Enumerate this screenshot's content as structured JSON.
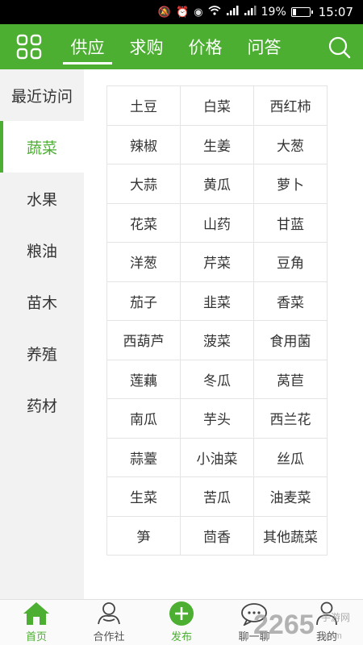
{
  "status_bar": {
    "battery_percent": "19%",
    "battery_level": 0.19,
    "time": "15:07",
    "icons": [
      "mute-icon",
      "alarm-icon",
      "eye-icon",
      "wifi-icon",
      "signal-4g-icon",
      "signal-3g-icon",
      "battery-icon"
    ]
  },
  "top_nav": {
    "menu_icon": "grid-menu-icon",
    "tabs": [
      {
        "label": "供应",
        "active": true
      },
      {
        "label": "求购",
        "active": false
      },
      {
        "label": "价格",
        "active": false
      },
      {
        "label": "问答",
        "active": false
      }
    ],
    "search_icon": "search-icon"
  },
  "sidebar": {
    "items": [
      {
        "label": "最近访问"
      },
      {
        "label": "蔬菜",
        "active": true
      },
      {
        "label": "水果"
      },
      {
        "label": "粮油"
      },
      {
        "label": "苗木"
      },
      {
        "label": "养殖"
      },
      {
        "label": "药材"
      }
    ]
  },
  "vegetables": [
    "土豆",
    "白菜",
    "西红柿",
    "辣椒",
    "生姜",
    "大葱",
    "大蒜",
    "黄瓜",
    "萝卜",
    "花菜",
    "山药",
    "甘蓝",
    "洋葱",
    "芹菜",
    "豆角",
    "茄子",
    "韭菜",
    "香菜",
    "西葫芦",
    "菠菜",
    "食用菌",
    "莲藕",
    "冬瓜",
    "莴苣",
    "南瓜",
    "芋头",
    "西兰花",
    "蒜薹",
    "小油菜",
    "丝瓜",
    "生菜",
    "苦瓜",
    "油麦菜",
    "笋",
    "茴香",
    "其他蔬菜"
  ],
  "bottom_nav": {
    "items": [
      {
        "label": "首页",
        "icon": "home-icon",
        "active": true
      },
      {
        "label": "合作社",
        "icon": "cooperative-icon"
      },
      {
        "label": "发布",
        "icon": "publish-plus-icon"
      },
      {
        "label": "聊一聊",
        "icon": "chat-icon"
      },
      {
        "label": "我的",
        "icon": "profile-icon"
      }
    ]
  },
  "colors": {
    "brand_green": "#4caf32",
    "sidebar_bg": "#f2f2f2",
    "grid_border": "#e4e4e4"
  },
  "watermark": {
    "text": "2265.com",
    "sub": "手游网"
  }
}
